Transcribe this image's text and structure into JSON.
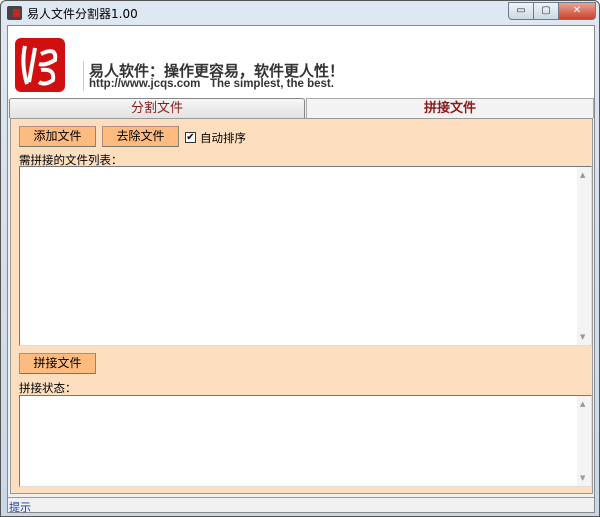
{
  "window": {
    "title": "易人文件分割器1.00",
    "minimize": "▭",
    "maximize": "▢",
    "close": "✕"
  },
  "header": {
    "logo_text": "易",
    "slogan": "易人软件：操作更容易，软件更人性！",
    "url_line": "http://www.jcqs.com   The simplest, the best."
  },
  "tabs": [
    {
      "label": "分割文件",
      "selected": false
    },
    {
      "label": "拼接文件",
      "selected": true
    }
  ],
  "merge": {
    "add_button": "添加文件",
    "remove_button": "去除文件",
    "auto_sort_label": "自动排序",
    "auto_sort_checked": true,
    "list_label": "需拼接的文件列表：",
    "merge_button": "拼接文件",
    "status_label": "拼接状态："
  },
  "statusbar": {
    "text": "提示"
  },
  "colors": {
    "panel": "#fddfc0",
    "button": "#fdbb80",
    "tab_text": "#8b1a1a",
    "logo": "#d01010"
  }
}
